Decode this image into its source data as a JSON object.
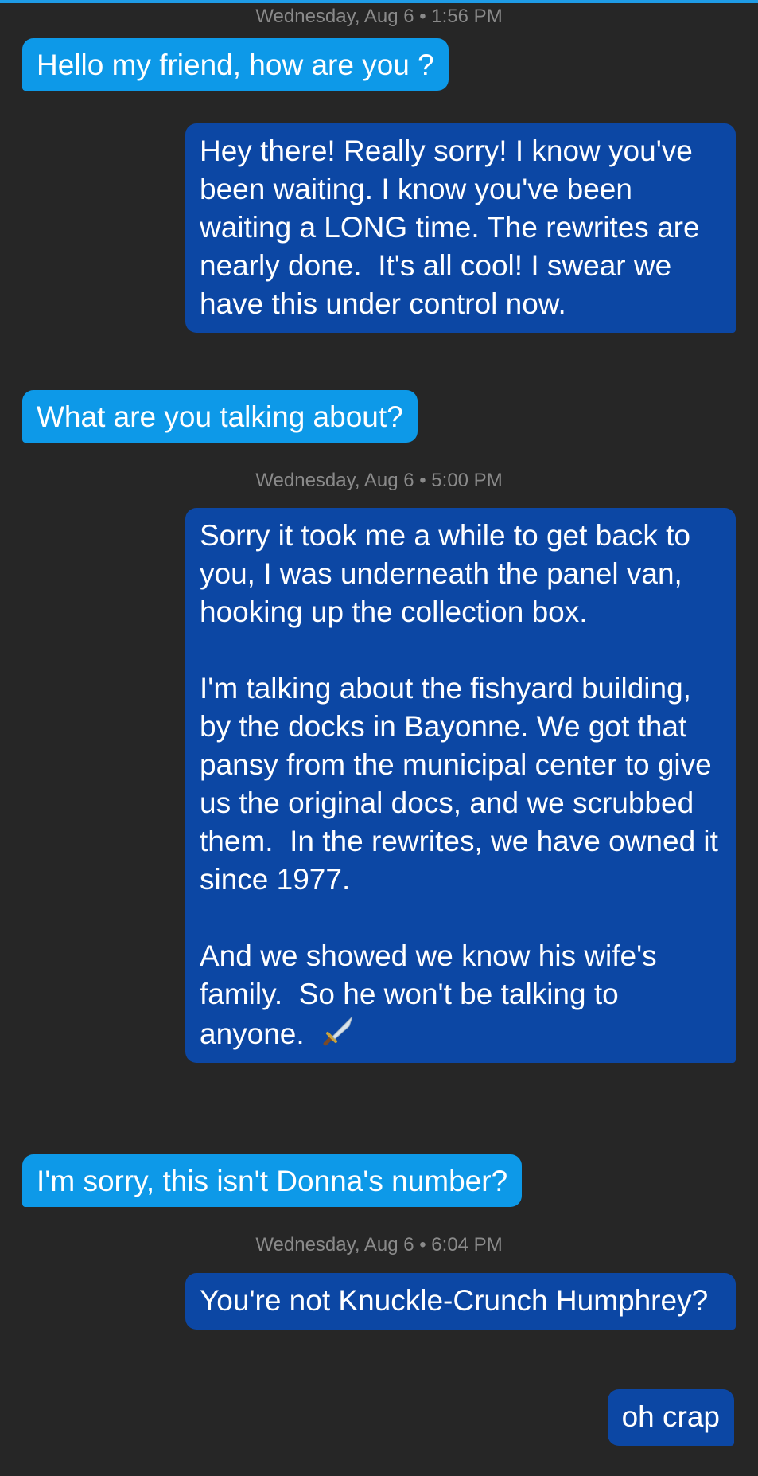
{
  "colors": {
    "background": "#262626",
    "incoming_bubble": "#0d99e8",
    "outgoing_bubble": "#0c47a4",
    "timestamp_text": "#8a8a8a",
    "accent_bar": "#1e9be6"
  },
  "timestamps": [
    "Wednesday, Aug 6 • 1:56 PM",
    "Wednesday, Aug 6 • 5:00 PM",
    "Wednesday, Aug 6 • 6:04 PM"
  ],
  "messages": [
    {
      "direction": "incoming",
      "text": "Hello my friend, how are you ?"
    },
    {
      "direction": "outgoing",
      "text": "Hey there! Really sorry! I know you've been waiting. I know you've been waiting a LONG time. The rewrites are nearly done.  It's all cool! I swear we have this under control now."
    },
    {
      "direction": "incoming",
      "text": "What are you talking about?"
    },
    {
      "direction": "outgoing",
      "text": "Sorry it took me a while to get back to you, I was underneath the panel van, hooking up the collection box.\n\nI'm talking about the fishyard building, by the docks in Bayonne. We got that pansy from the municipal center to give us the original docs, and we scrubbed them.  In the rewrites, we have owned it since 1977.\n\nAnd we showed we know his wife's family.  So he won't be talking to anyone.",
      "trailing_icon": "dagger-icon"
    },
    {
      "direction": "incoming",
      "text": "I'm sorry, this isn't Donna's number?"
    },
    {
      "direction": "outgoing",
      "text": "You're not Knuckle-Crunch Humphrey?"
    },
    {
      "direction": "outgoing",
      "text": "oh crap"
    }
  ]
}
